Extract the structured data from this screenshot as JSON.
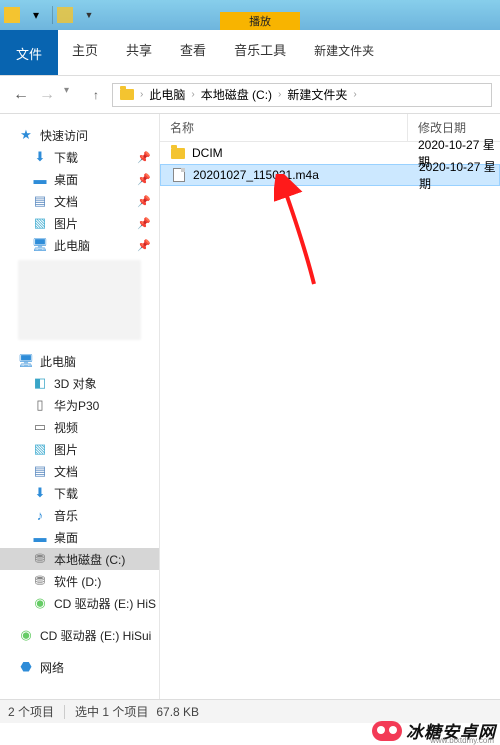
{
  "titlebar": {
    "play_label": "播放",
    "folder_name": "新建文件夹"
  },
  "ribbon": {
    "file": "文件",
    "home": "主页",
    "share": "共享",
    "view": "查看",
    "music_tools": "音乐工具"
  },
  "breadcrumb": {
    "items": [
      "此电脑",
      "本地磁盘 (C:)",
      "新建文件夹"
    ]
  },
  "sidebar": {
    "quick_access": "快速访问",
    "downloads": "下载",
    "desktop": "桌面",
    "documents": "文档",
    "pictures": "图片",
    "this_pc_quick": "此电脑",
    "this_pc": "此电脑",
    "objects3d": "3D 对象",
    "huawei": "华为P30",
    "videos": "视频",
    "pictures2": "图片",
    "documents2": "文档",
    "downloads2": "下载",
    "music": "音乐",
    "desktop2": "桌面",
    "local_c": "本地磁盘 (C:)",
    "local_d": "软件 (D:)",
    "cd_e_his": "CD 驱动器 (E:) HiS",
    "cd_e_hisui": "CD 驱动器 (E:) HiSui",
    "network": "网络"
  },
  "columns": {
    "name": "名称",
    "date": "修改日期"
  },
  "files": [
    {
      "icon": "folder",
      "name": "DCIM",
      "date": "2020-10-27 星期",
      "selected": false
    },
    {
      "icon": "file",
      "name": "20201027_115021.m4a",
      "date": "2020-10-27 星期",
      "selected": true
    }
  ],
  "status": {
    "count": "2 个项目",
    "selected": "选中 1 个项目",
    "size": "67.8 KB"
  },
  "watermark": {
    "text": "冰糖安卓网",
    "sub": "www.btxtdmy.com"
  }
}
